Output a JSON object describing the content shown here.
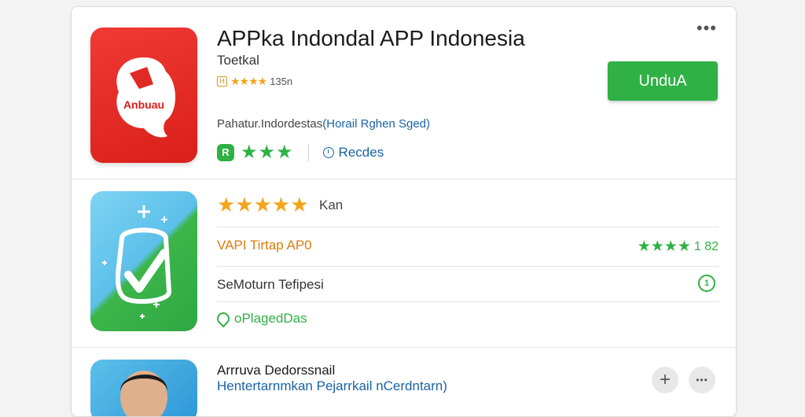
{
  "header": {
    "more_label": "•••"
  },
  "app1": {
    "icon_text": "Anbuau",
    "title": "APPka Indondal APP Indonesia",
    "developer": "Toetkal",
    "small_badge": "H",
    "rating_stars": "★★★★",
    "rating_text": "135n",
    "install_label": "UnduA",
    "desc_prefix": "Pahatur.Indordestas",
    "desc_link": "(Horail Rghen Sged)",
    "badge_glyph": "R",
    "green_stars": "★★★",
    "reviews_label": "Recdes"
  },
  "app2": {
    "stars": "★★★★★",
    "kan_label": "Kan",
    "row1_label": "VAPI Tirtap AP0",
    "row1_stars": "★★★★",
    "row1_value": "1 82",
    "row2_label": "SeMoturn Tefipesi",
    "row2_icon_glyph": "1",
    "row3_label": "oPlagedDas"
  },
  "app3": {
    "name": "Arrruva Dedorssnail",
    "subtitle": "Hentertarnmkan Pejarrkail nCerdntarn)",
    "plus_label": "+",
    "dots_label": "•••"
  },
  "colors": {
    "install": "#2fb145",
    "app1_icon": "#e02a24",
    "link": "#1a63a8",
    "orange": "#f2a51c"
  }
}
